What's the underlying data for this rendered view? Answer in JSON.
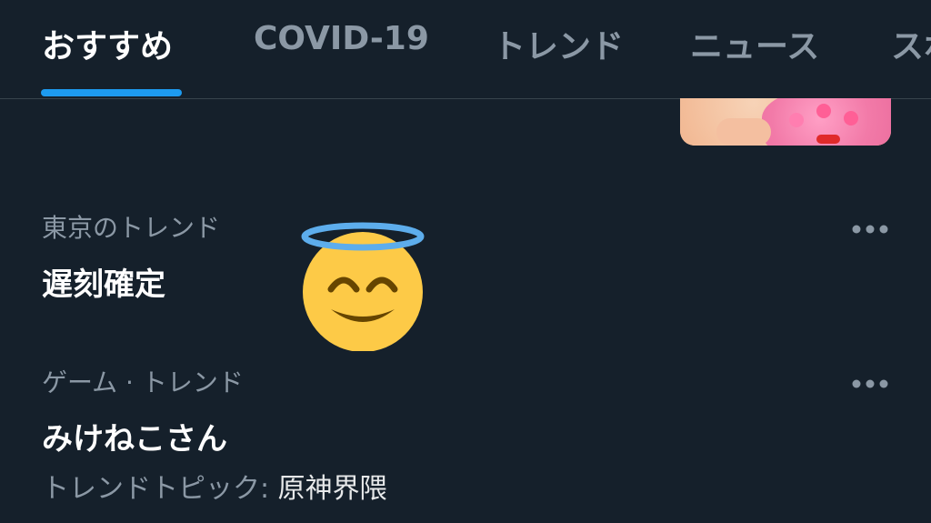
{
  "tabs": [
    {
      "label": "おすすめ",
      "active": true
    },
    {
      "label": "COVID-19",
      "active": false
    },
    {
      "label": "トレンド",
      "active": false
    },
    {
      "label": "ニュース",
      "active": false
    },
    {
      "label": "スポ",
      "active": false
    }
  ],
  "trends": [
    {
      "context": "東京のトレンド",
      "title": "遅刻確定",
      "more_icon": "more-horizontal-icon"
    },
    {
      "context": "ゲーム · トレンド",
      "title": "みけねこさん",
      "meta_prefix": "トレンドトピック: ",
      "meta_topic": "原神界隈",
      "more_icon": "more-horizontal-icon"
    }
  ],
  "emoji": {
    "name": "smiling-face-with-halo"
  },
  "colors": {
    "background": "#15202b",
    "accent": "#1d9bf0",
    "text_primary": "#ffffff",
    "text_secondary": "#8b98a5",
    "divider": "#38444d"
  }
}
